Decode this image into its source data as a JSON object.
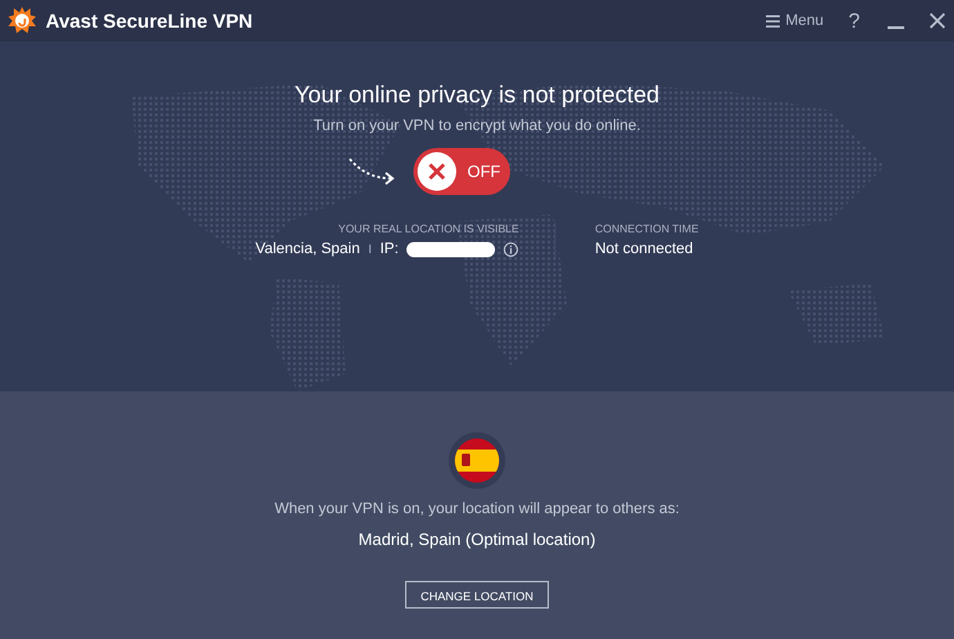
{
  "window": {
    "title": "Avast SecureLine VPN",
    "menu": "Menu",
    "help": "?"
  },
  "status": {
    "headline": "Your online privacy is not protected",
    "subtitle": "Turn on your VPN to encrypt what you do online.",
    "toggle": {
      "on": false,
      "label": "OFF"
    }
  },
  "location": {
    "heading": "YOUR REAL LOCATION IS VISIBLE",
    "place": "Valencia, Spain",
    "separator": "I",
    "ip_label": "IP:"
  },
  "connection": {
    "heading": "CONNECTION TIME",
    "value": "Not connected"
  },
  "virtual_location": {
    "note": "When your VPN is on, your location will appear to others as:",
    "place": "Madrid, Spain (Optimal location)",
    "button": "CHANGE LOCATION"
  }
}
